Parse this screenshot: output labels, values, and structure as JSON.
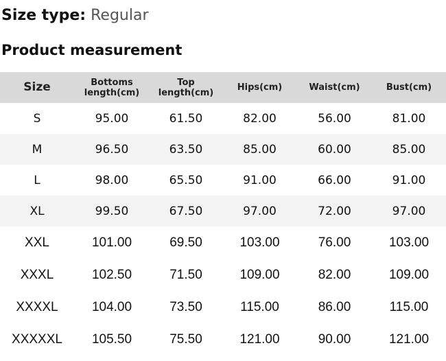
{
  "size_type": {
    "label": "Size type:",
    "value": "Regular"
  },
  "section_title": "Product measurement",
  "table": {
    "headers": [
      "Size",
      "Bottoms length(cm)",
      "Top length(cm)",
      "Hips(cm)",
      "Waist(cm)",
      "Bust(cm)"
    ],
    "rows": [
      [
        "S",
        "95.00",
        "61.50",
        "82.00",
        "56.00",
        "81.00"
      ],
      [
        "M",
        "96.50",
        "63.50",
        "85.00",
        "60.00",
        "85.00"
      ],
      [
        "L",
        "98.00",
        "65.50",
        "91.00",
        "66.00",
        "91.00"
      ],
      [
        "XL",
        "99.50",
        "67.50",
        "97.00",
        "72.00",
        "97.00"
      ],
      [
        "XXL",
        "101.00",
        "69.50",
        "103.00",
        "76.00",
        "103.00"
      ],
      [
        "XXXL",
        "102.50",
        "71.50",
        "109.00",
        "82.00",
        "109.00"
      ],
      [
        "XXXXL",
        "104.00",
        "73.50",
        "115.00",
        "86.00",
        "115.00"
      ],
      [
        "XXXXXL",
        "105.50",
        "75.50",
        "121.00",
        "90.00",
        "121.00"
      ]
    ]
  }
}
